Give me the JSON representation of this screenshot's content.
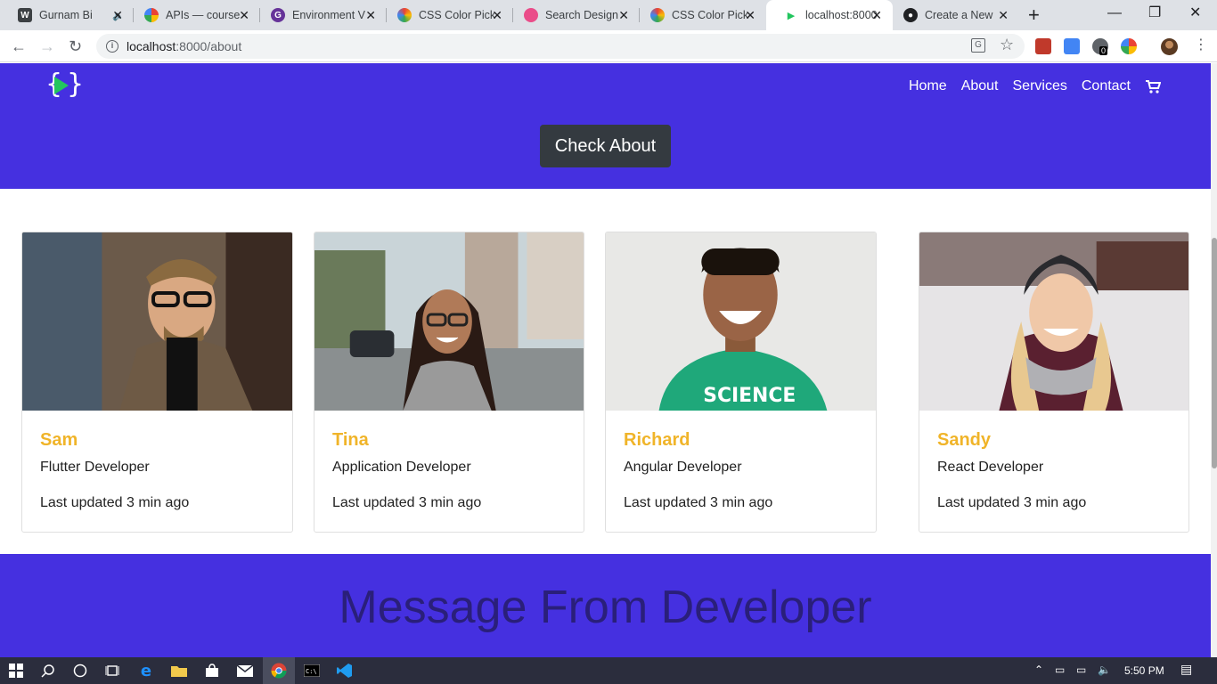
{
  "browser": {
    "tabs": [
      {
        "title": "Gurnam Bi",
        "favicon": "wordpress-icon",
        "color": "#3c4043",
        "active": false,
        "audio": true
      },
      {
        "title": "APIs — course",
        "favicon": "google-cloud-icon",
        "color": "#4285f4",
        "active": false
      },
      {
        "title": "Environment V",
        "favicon": "gatsby-icon",
        "color": "#663399",
        "active": false
      },
      {
        "title": "CSS Color Pick",
        "favicon": "color-picker-icon",
        "color": "#e8a33d",
        "active": false
      },
      {
        "title": "Search Design",
        "favicon": "dribbble-icon",
        "color": "#ea4c89",
        "active": false
      },
      {
        "title": "CSS Color Pick",
        "favicon": "color-picker-icon",
        "color": "#e8a33d",
        "active": false
      },
      {
        "title": "localhost:8000",
        "favicon": "play-icon",
        "color": "#22c55e",
        "active": true
      },
      {
        "title": "Create a New",
        "favicon": "github-icon",
        "color": "#202124",
        "active": false
      }
    ],
    "url_host": "localhost",
    "url_path": ":8000/about",
    "window_controls": {
      "minimize": "—",
      "restore": "❐",
      "close": "✕"
    },
    "extension_badge": "0"
  },
  "site": {
    "brand_color": "#4530e0",
    "accent_color": "#f0b429",
    "nav": [
      "Home",
      "About",
      "Services",
      "Contact"
    ],
    "cart_icon": "cart-icon",
    "cta_label": "Check About",
    "team": [
      {
        "name": "Sam",
        "role": "Flutter Developer",
        "updated": "Last updated 3 min ago"
      },
      {
        "name": "Tina",
        "role": "Application Developer",
        "updated": "Last updated 3 min ago"
      },
      {
        "name": "Richard",
        "role": "Angular Developer",
        "updated": "Last updated 3 min ago"
      },
      {
        "name": "Sandy",
        "role": "React Developer",
        "updated": "Last updated 3 min ago"
      }
    ],
    "message_heading": "Message From Developer"
  },
  "taskbar": {
    "time": "5:50 PM"
  }
}
